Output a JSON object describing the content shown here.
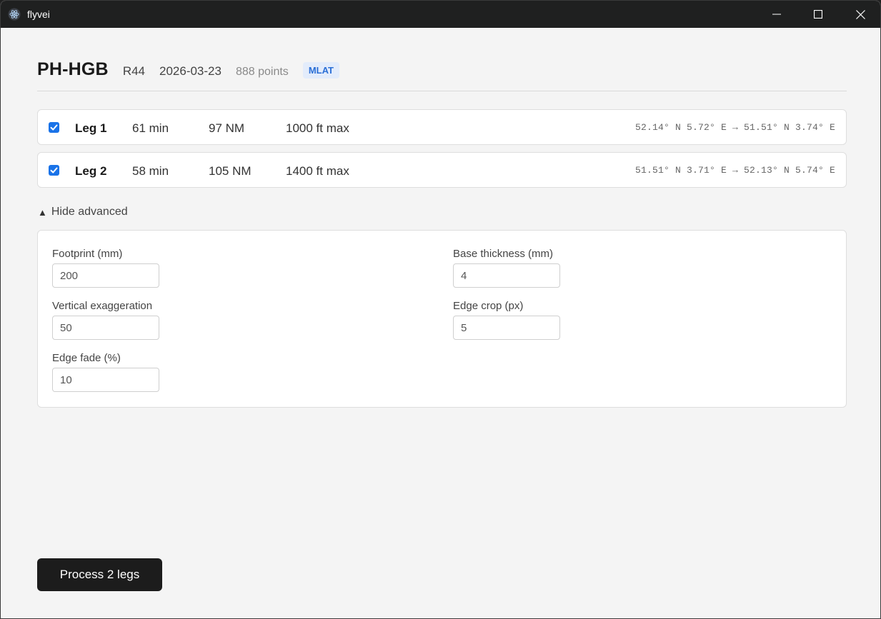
{
  "window": {
    "title": "flyvei"
  },
  "flight": {
    "registration": "PH-HGB",
    "aircraft_type": "R44",
    "date": "2026-03-23",
    "points": "888 points",
    "source_badge": "MLAT"
  },
  "legs": [
    {
      "checked": true,
      "name": "Leg 1",
      "duration": "61 min",
      "distance": "97 NM",
      "altitude": "1000 ft max",
      "coords": "52.14° N 5.72° E → 51.51° N 3.74° E"
    },
    {
      "checked": true,
      "name": "Leg 2",
      "duration": "58 min",
      "distance": "105 NM",
      "altitude": "1400 ft max",
      "coords": "51.51° N 3.71° E → 52.13° N 5.74° E"
    }
  ],
  "advanced": {
    "toggle_icon": "▲",
    "toggle_label": "Hide advanced",
    "fields": {
      "footprint": {
        "label": "Footprint (mm)",
        "value": "200"
      },
      "vertical_exaggeration": {
        "label": "Vertical exaggeration",
        "value": "50"
      },
      "edge_fade": {
        "label": "Edge fade (%)",
        "value": "10"
      },
      "base_thickness": {
        "label": "Base thickness (mm)",
        "value": "4"
      },
      "edge_crop": {
        "label": "Edge crop (px)",
        "value": "5"
      }
    }
  },
  "actions": {
    "process_label": "Process 2 legs"
  },
  "colors": {
    "accent": "#1a73e8",
    "badge_text": "#2b6fd6",
    "badge_bg": "#e3ecfb",
    "button_bg": "#1c1c1c"
  },
  "icons": {
    "app": "atom-icon",
    "minimize": "minimize-icon",
    "maximize": "maximize-icon",
    "close": "close-icon",
    "check": "check-icon"
  }
}
